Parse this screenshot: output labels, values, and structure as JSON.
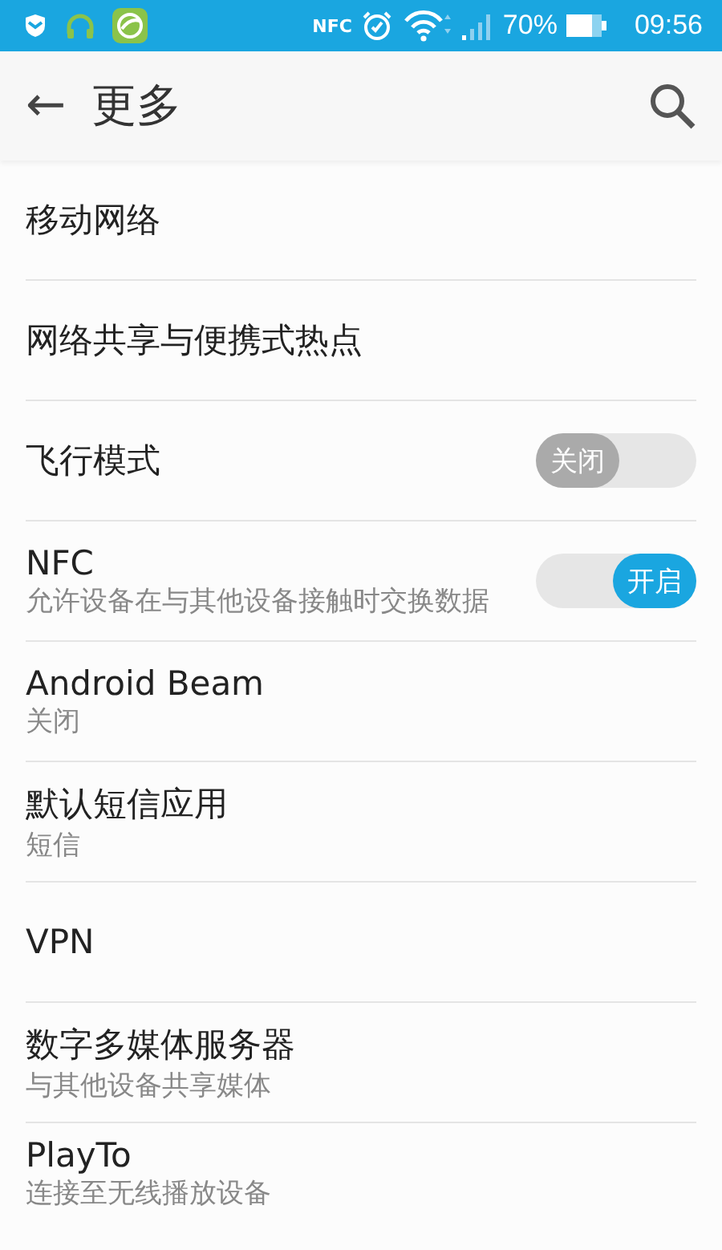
{
  "status_bar": {
    "nfc_label": "NFC",
    "battery": "70%",
    "time": "09:56"
  },
  "header": {
    "title": "更多",
    "back": "←"
  },
  "items": [
    {
      "kind": "plain",
      "title": "移动网络"
    },
    {
      "kind": "plain",
      "title": "网络共享与便携式热点"
    },
    {
      "kind": "switch",
      "title": "飞行模式",
      "on": false,
      "switch_label": "关闭"
    },
    {
      "kind": "switch",
      "title": "NFC",
      "subtitle": "允许设备在与其他设备接触时交换数据",
      "on": true,
      "switch_label": "开启"
    },
    {
      "kind": "plain",
      "title": "Android Beam",
      "subtitle": "关闭"
    },
    {
      "kind": "plain",
      "title": "默认短信应用",
      "subtitle": "短信"
    },
    {
      "kind": "plain",
      "title": "VPN"
    },
    {
      "kind": "plain",
      "title": "数字多媒体服务器",
      "subtitle": "与其他设备共享媒体"
    },
    {
      "kind": "plain",
      "title": "PlayTo",
      "subtitle": "连接至无线播放设备"
    }
  ]
}
